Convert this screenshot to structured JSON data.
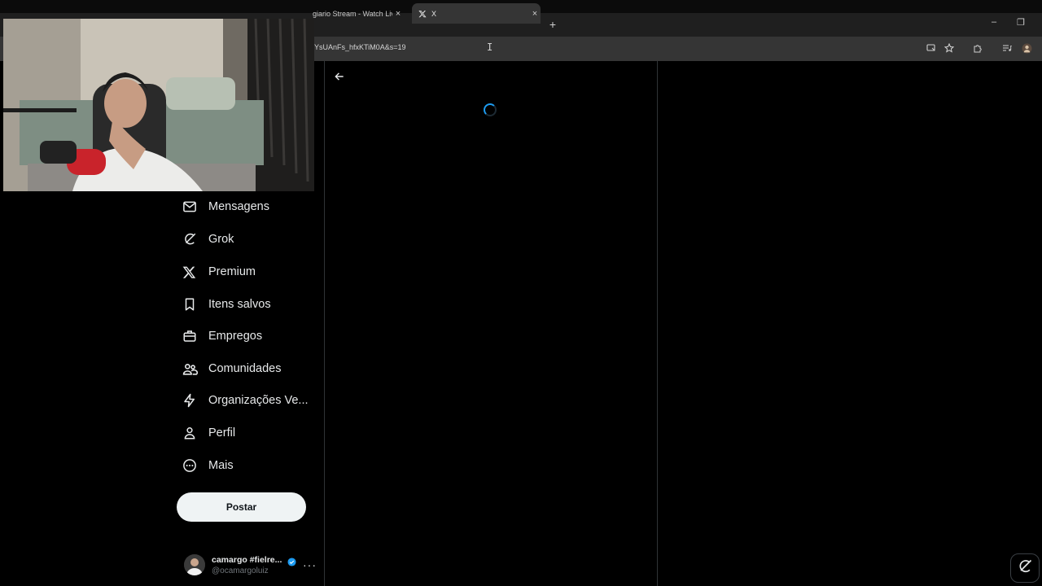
{
  "browser": {
    "tabs": [
      {
        "title": "giario Stream - Watch Liv"
      },
      {
        "title": "X"
      }
    ],
    "new_tab": "+",
    "tab_close": "×",
    "url": "YsUAnFs_hfxKTiM0A&s=19",
    "window_minimize": "–",
    "window_restore": "❐"
  },
  "webcam": {
    "description_icon": "webcam-video-feed"
  },
  "sidebar": {
    "items": [
      {
        "label": "Mensagens",
        "icon": "mail-icon"
      },
      {
        "label": "Grok",
        "icon": "grok-icon"
      },
      {
        "label": "Premium",
        "icon": "x-logo-icon"
      },
      {
        "label": "Itens salvos",
        "icon": "bookmark-icon"
      },
      {
        "label": "Empregos",
        "icon": "briefcase-icon"
      },
      {
        "label": "Comunidades",
        "icon": "communities-icon"
      },
      {
        "label": "Organizações Ve...",
        "icon": "lightning-icon"
      },
      {
        "label": "Perfil",
        "icon": "person-icon"
      },
      {
        "label": "Mais",
        "icon": "more-circle-icon"
      }
    ],
    "post_button": "Postar",
    "account": {
      "name": "camargo #fielre...",
      "handle": "@ocamargoluiz",
      "more": "···"
    }
  },
  "colors": {
    "background": "#000000",
    "text": "#e7e9ea",
    "secondary_text": "#71767b",
    "accent": "#1d9bf0",
    "border": "#2f3336",
    "button_bg": "#eff3f4"
  }
}
